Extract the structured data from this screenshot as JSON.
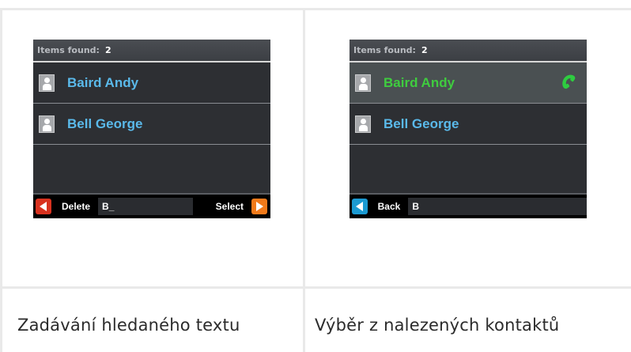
{
  "left_screen": {
    "header_label": "Items found:",
    "header_count": "2",
    "contacts": [
      {
        "name": "Baird Andy",
        "selected": false
      },
      {
        "name": "Bell George",
        "selected": false
      }
    ],
    "footer": {
      "delete_label": "Delete",
      "input_value": "B_",
      "select_label": "Select"
    }
  },
  "right_screen": {
    "header_label": "Items found:",
    "header_count": "2",
    "contacts": [
      {
        "name": "Baird Andy",
        "selected": true
      },
      {
        "name": "Bell George",
        "selected": false
      }
    ],
    "footer": {
      "back_label": "Back",
      "input_value": "B"
    }
  },
  "captions": {
    "left": "Zadávání hledaného textu",
    "right": "Výběr z nalezených kontaktů"
  },
  "colors": {
    "contact_name": "#5ab9ea",
    "selected_name": "#3fcc3f",
    "delete_button": "#d8321f",
    "select_button": "#f27a1a",
    "back_button": "#1b9ad2",
    "call_icon": "#2ecc40"
  },
  "icons": {
    "avatar": "person-icon",
    "call": "phone-icon",
    "left_arrow": "arrow-left-icon",
    "right_arrow": "arrow-right-icon"
  }
}
